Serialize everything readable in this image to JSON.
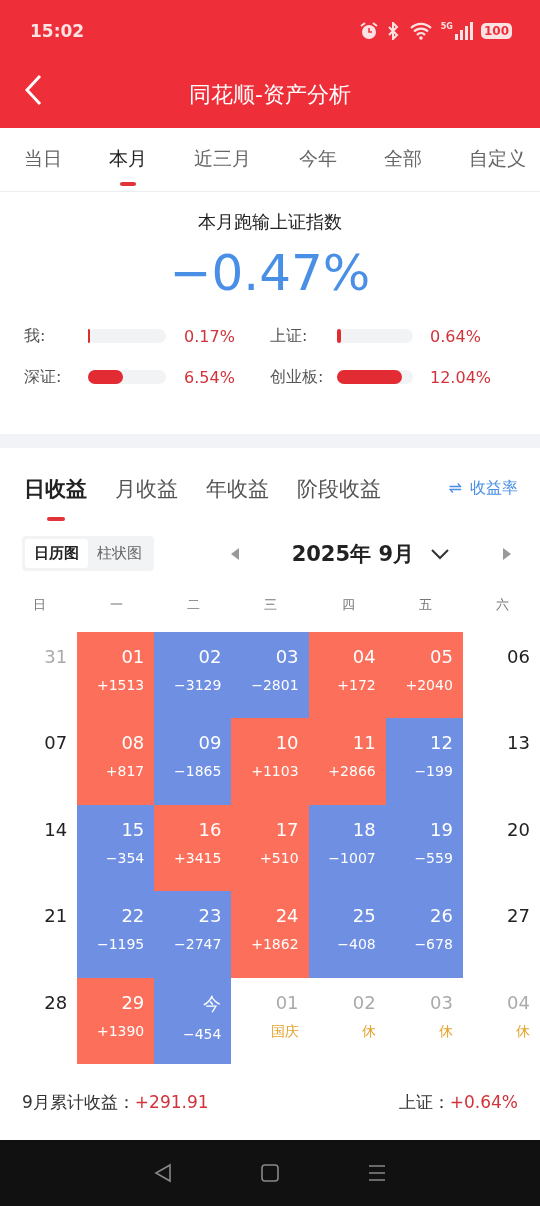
{
  "status_bar": {
    "time": "15:02",
    "network": "5G",
    "battery": "100"
  },
  "header": {
    "title": "同花顺-资产分析"
  },
  "period_tabs": [
    {
      "label": "当日",
      "selected": false
    },
    {
      "label": "本月",
      "selected": true
    },
    {
      "label": "近三月",
      "selected": false
    },
    {
      "label": "今年",
      "selected": false
    },
    {
      "label": "全部",
      "selected": false
    },
    {
      "label": "自定义",
      "selected": false
    }
  ],
  "summary": {
    "title": "本月跑输上证指数",
    "value": "−0.47%"
  },
  "comparisons": [
    {
      "label": "我:",
      "level": 0.01,
      "value": "0.17%"
    },
    {
      "label": "上证:",
      "level": 0.05,
      "value": "0.64%"
    },
    {
      "label": "深证:",
      "level": 0.45,
      "value": "6.54%"
    },
    {
      "label": "创业板:",
      "level": 0.85,
      "value": "12.04%"
    }
  ],
  "profit_tabs": [
    {
      "label": "日收益",
      "selected": true
    },
    {
      "label": "月收益",
      "selected": false
    },
    {
      "label": "年收益",
      "selected": false
    },
    {
      "label": "阶段收益",
      "selected": false
    }
  ],
  "rate_toggle": {
    "icon": "⇌",
    "label": "收益率"
  },
  "view_toggle": [
    {
      "label": "日历图",
      "selected": true
    },
    {
      "label": "柱状图",
      "selected": false
    }
  ],
  "month": "2025年 9月",
  "weekdays": [
    "日",
    "一",
    "二",
    "三",
    "四",
    "五",
    "六"
  ],
  "weeks": [
    [
      {
        "kind": "other",
        "day": "31"
      },
      {
        "kind": "gain",
        "day": "01",
        "amount": "+1513"
      },
      {
        "kind": "loss",
        "day": "02",
        "amount": "−3129"
      },
      {
        "kind": "loss",
        "day": "03",
        "amount": "−2801"
      },
      {
        "kind": "gain",
        "day": "04",
        "amount": "+172"
      },
      {
        "kind": "gain",
        "day": "05",
        "amount": "+2040"
      },
      {
        "kind": "weekend",
        "day": "06"
      }
    ],
    [
      {
        "kind": "weekend",
        "day": "07"
      },
      {
        "kind": "gain",
        "day": "08",
        "amount": "+817"
      },
      {
        "kind": "loss",
        "day": "09",
        "amount": "−1865"
      },
      {
        "kind": "gain",
        "day": "10",
        "amount": "+1103"
      },
      {
        "kind": "gain",
        "day": "11",
        "amount": "+2866"
      },
      {
        "kind": "loss",
        "day": "12",
        "amount": "−199"
      },
      {
        "kind": "weekend",
        "day": "13"
      }
    ],
    [
      {
        "kind": "weekend",
        "day": "14"
      },
      {
        "kind": "loss",
        "day": "15",
        "amount": "−354"
      },
      {
        "kind": "gain",
        "day": "16",
        "amount": "+3415"
      },
      {
        "kind": "gain",
        "day": "17",
        "amount": "+510"
      },
      {
        "kind": "loss",
        "day": "18",
        "amount": "−1007"
      },
      {
        "kind": "loss",
        "day": "19",
        "amount": "−559"
      },
      {
        "kind": "weekend",
        "day": "20"
      }
    ],
    [
      {
        "kind": "weekend",
        "day": "21"
      },
      {
        "kind": "loss",
        "day": "22",
        "amount": "−1195"
      },
      {
        "kind": "loss",
        "day": "23",
        "amount": "−2747"
      },
      {
        "kind": "gain",
        "day": "24",
        "amount": "+1862"
      },
      {
        "kind": "loss",
        "day": "25",
        "amount": "−408"
      },
      {
        "kind": "loss",
        "day": "26",
        "amount": "−678"
      },
      {
        "kind": "weekend",
        "day": "27"
      }
    ],
    [
      {
        "kind": "weekend",
        "day": "28"
      },
      {
        "kind": "gain",
        "day": "29",
        "amount": "+1390"
      },
      {
        "kind": "loss",
        "day": "今",
        "amount": "−454"
      },
      {
        "kind": "other",
        "day": "01",
        "note": "国庆"
      },
      {
        "kind": "other",
        "day": "02",
        "note": "休"
      },
      {
        "kind": "other",
        "day": "03",
        "note": "休"
      },
      {
        "kind": "other",
        "day": "04",
        "note": "休"
      }
    ]
  ],
  "footer": {
    "total_label": "9月累计收益：",
    "total_value": "+291.91",
    "index_label": "上证：",
    "index_value": "+0.64%"
  }
}
